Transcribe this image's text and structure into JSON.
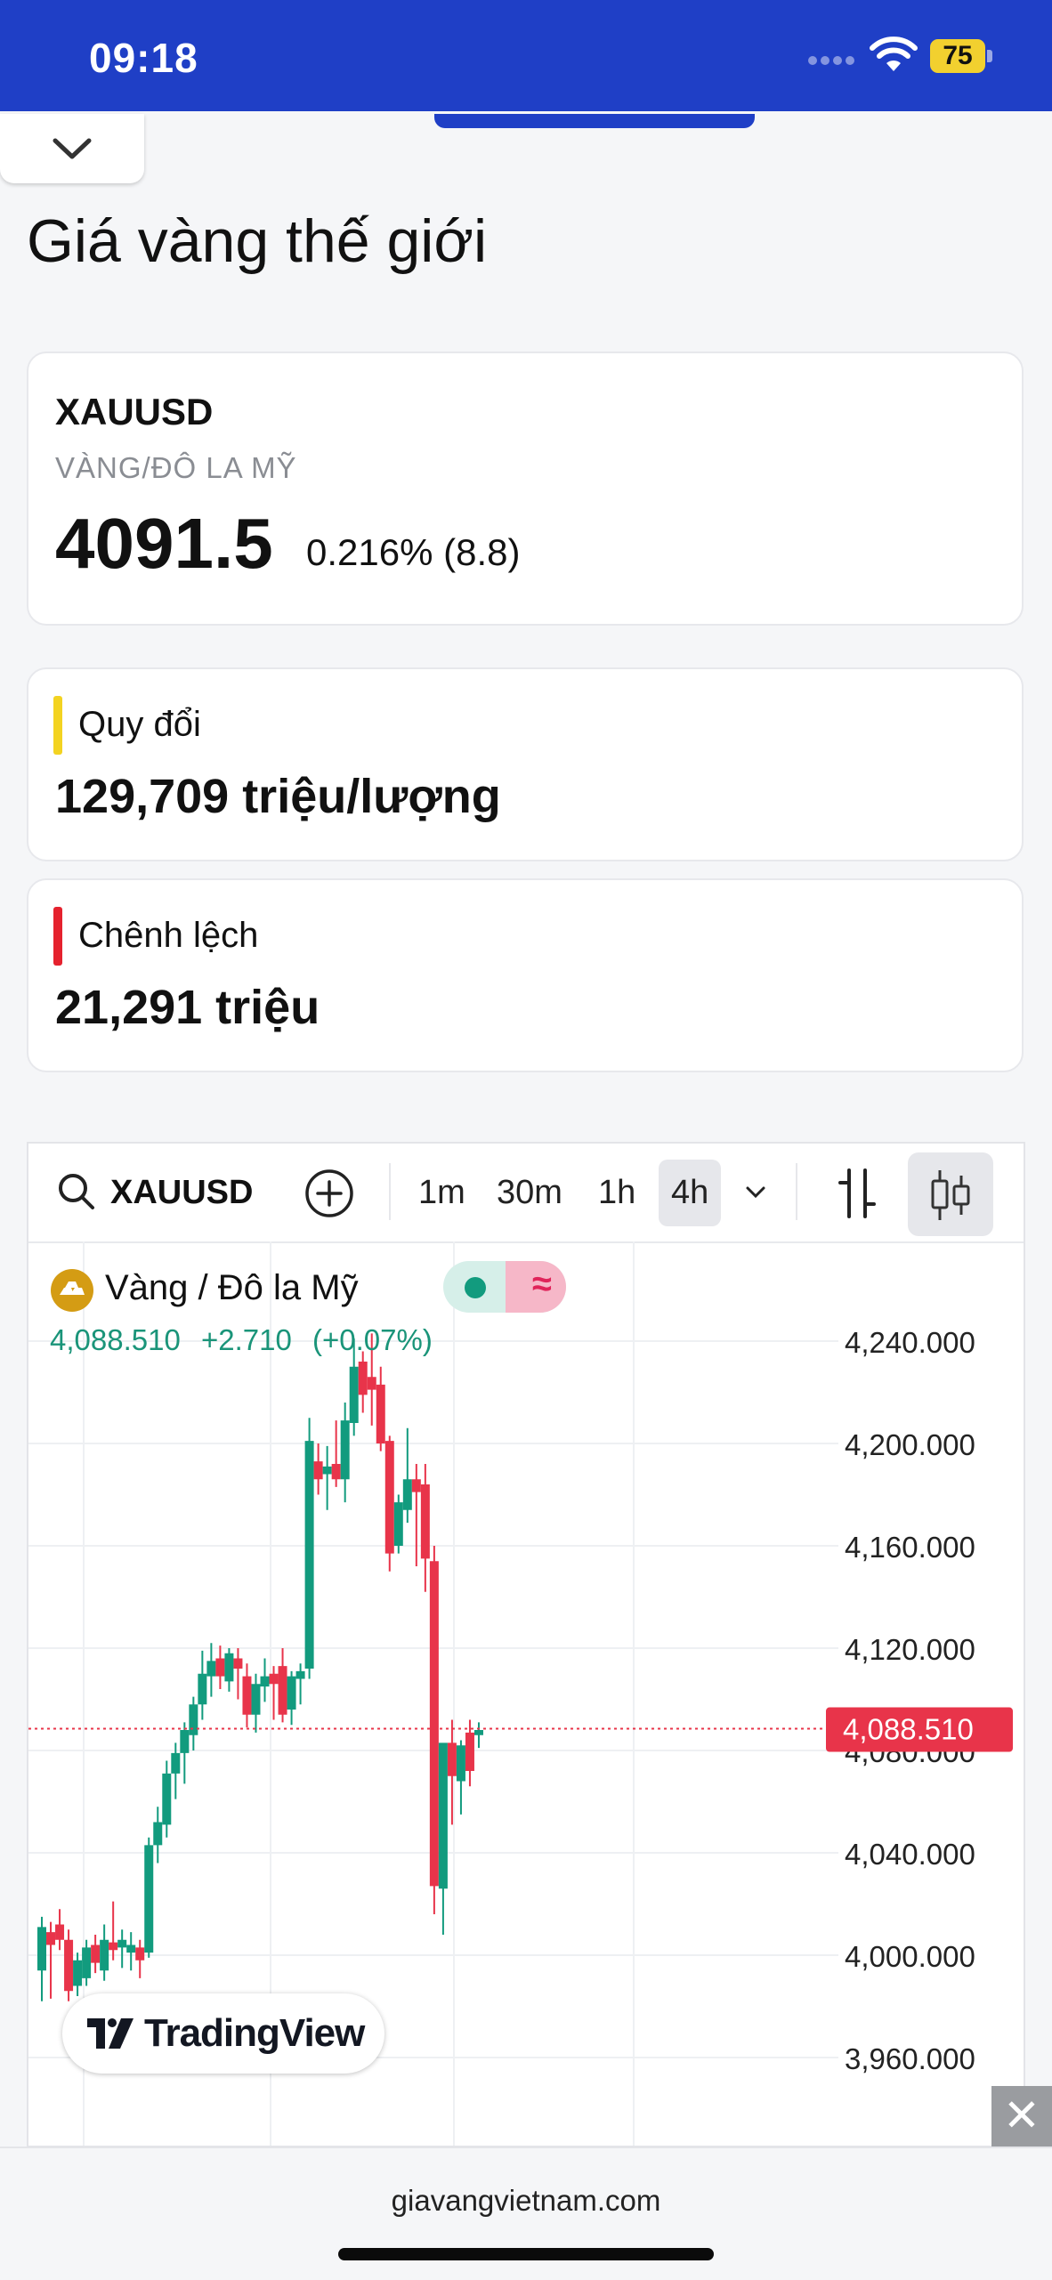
{
  "status_bar": {
    "time": "09:18",
    "battery": "75",
    "wifi_icon": "wifi-icon"
  },
  "page": {
    "title": "Giá vàng thế giới"
  },
  "quote": {
    "symbol": "XAUUSD",
    "name": "VÀNG/ĐÔ LA MỸ",
    "price": "4091.5",
    "change": "0.216% (8.8)"
  },
  "conversion": {
    "label": "Quy đổi",
    "value": "129,709 triệu/lượng",
    "accent": "#f3d321"
  },
  "spread": {
    "label": "Chênh lệch",
    "value": "21,291 triệu",
    "accent": "#e5222e"
  },
  "widget": {
    "toolbar": {
      "symbol": "XAUUSD",
      "intervals": [
        "1m",
        "30m",
        "1h",
        "4h"
      ],
      "active_interval": "4h"
    },
    "legend": {
      "name": "Vàng / Đô la Mỹ",
      "last": "4,088.510",
      "change": "+2.710",
      "change_pct": "(+0.07%)",
      "up_color": "#129b7e",
      "down_color": "#e8344a"
    },
    "brand": "TradingView"
  },
  "chart_data": {
    "type": "candlestick",
    "y_ticks": [
      "4,240.000",
      "4,200.000",
      "4,160.000",
      "4,120.000",
      "4,080.000",
      "4,040.000",
      "4,000.000",
      "3,960.000"
    ],
    "y_tick_values": [
      4240,
      4200,
      4160,
      4120,
      4080,
      4040,
      4000,
      3960
    ],
    "last_price_label": "4,088.510",
    "last_price": 4088.51,
    "grid": true,
    "ohlc": [
      [
        3994,
        4015,
        3982,
        4011
      ],
      [
        4009,
        4013,
        3983,
        4004
      ],
      [
        4012,
        4018,
        4002,
        4006
      ],
      [
        4006,
        4010,
        3982,
        3986
      ],
      [
        3988,
        4001,
        3984,
        3998
      ],
      [
        3991,
        4006,
        3988,
        4003
      ],
      [
        4004,
        4008,
        3993,
        3997
      ],
      [
        3994,
        4012,
        3990,
        4006
      ],
      [
        4005,
        4021,
        3998,
        4002
      ],
      [
        4003,
        4010,
        3995,
        4006
      ],
      [
        4001,
        4009,
        3994,
        4004
      ],
      [
        4003,
        4006,
        3991,
        3998
      ],
      [
        4001,
        4046,
        3999,
        4043
      ],
      [
        4043,
        4058,
        4036,
        4052
      ],
      [
        4051,
        4076,
        4046,
        4071
      ],
      [
        4071,
        4083,
        4061,
        4079
      ],
      [
        4079,
        4091,
        4067,
        4088
      ],
      [
        4086,
        4101,
        4080,
        4098
      ],
      [
        4098,
        4119,
        4092,
        4110
      ],
      [
        4109,
        4122,
        4101,
        4115
      ],
      [
        4116,
        4121,
        4104,
        4109
      ],
      [
        4107,
        4120,
        4103,
        4118
      ],
      [
        4116,
        4120,
        4100,
        4112
      ],
      [
        4109,
        4114,
        4089,
        4094
      ],
      [
        4094,
        4110,
        4087,
        4106
      ],
      [
        4105,
        4116,
        4099,
        4109
      ],
      [
        4110,
        4113,
        4092,
        4106
      ],
      [
        4113,
        4120,
        4091,
        4094
      ],
      [
        4096,
        4111,
        4090,
        4109
      ],
      [
        4108,
        4114,
        4098,
        4111
      ],
      [
        4112,
        4210,
        4108,
        4201
      ],
      [
        4193,
        4200,
        4180,
        4186
      ],
      [
        4188,
        4199,
        4174,
        4191
      ],
      [
        4192,
        4209,
        4183,
        4186
      ],
      [
        4186,
        4216,
        4177,
        4209
      ],
      [
        4208,
        4241,
        4203,
        4230
      ],
      [
        4232,
        4236,
        4212,
        4219
      ],
      [
        4226,
        4243,
        4207,
        4221
      ],
      [
        4223,
        4230,
        4197,
        4200
      ],
      [
        4201,
        4203,
        4150,
        4157
      ],
      [
        4160,
        4180,
        4157,
        4177
      ],
      [
        4174,
        4206,
        4169,
        4186
      ],
      [
        4186,
        4192,
        4152,
        4181
      ],
      [
        4184,
        4192,
        4142,
        4155
      ],
      [
        4154,
        4160,
        4016,
        4027
      ],
      [
        4026,
        4079,
        4008,
        4083
      ],
      [
        4083,
        4092,
        4051,
        4070
      ],
      [
        4068,
        4084,
        4055,
        4082
      ],
      [
        4087,
        4092,
        4066,
        4072
      ],
      [
        4086,
        4091,
        4081,
        4088
      ]
    ]
  }
}
